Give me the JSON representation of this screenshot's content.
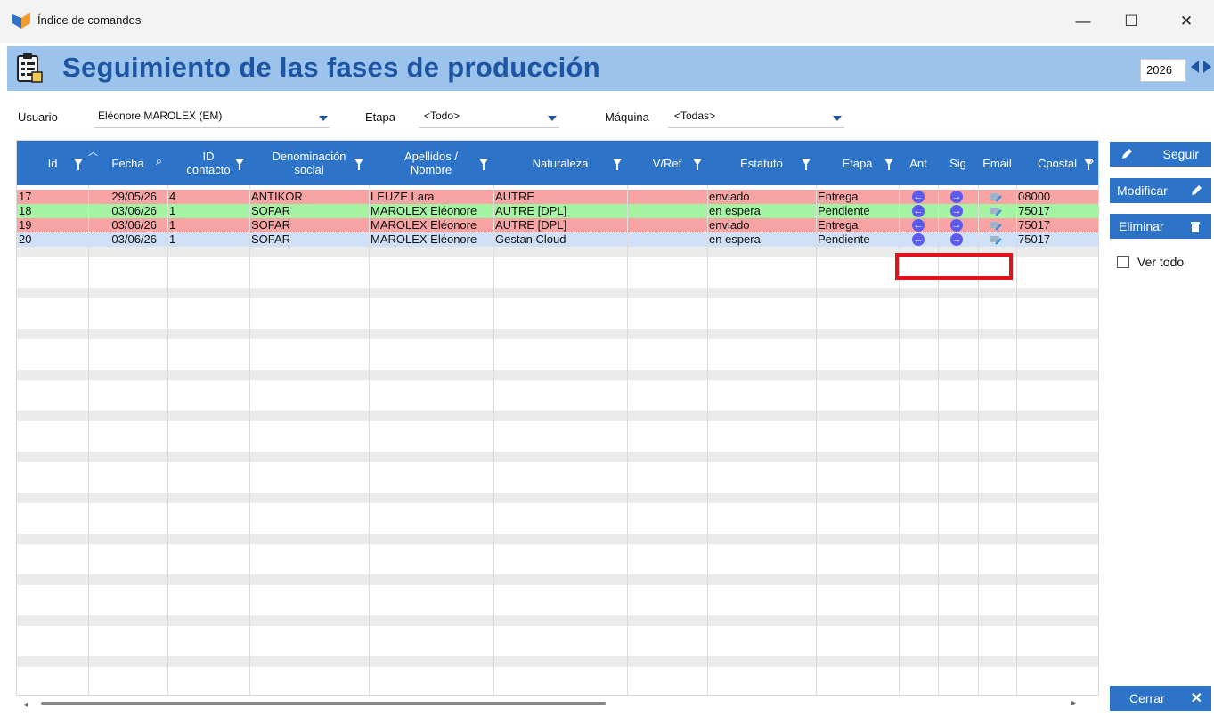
{
  "window": {
    "title": "Índice de comandos",
    "minimize": "—",
    "maximize": "☐",
    "close": "✕"
  },
  "header": {
    "title": "Seguimiento de las fases de producción",
    "year": "2026"
  },
  "filters": {
    "user_label": "Usuario",
    "user_value": "Eléonore MAROLEX (EM)",
    "stage_label": "Etapa",
    "stage_value": "<Todo>",
    "machine_label": "Máquina",
    "machine_value": "<Todas>"
  },
  "columns": [
    {
      "label": "Id",
      "filter": true
    },
    {
      "label": "Fecha",
      "search": true
    },
    {
      "label": "ID\ncontacto",
      "filter": true
    },
    {
      "label": "Denominación\nsocial",
      "filter": true
    },
    {
      "label": "Apellidos /\nNombre",
      "filter": true
    },
    {
      "label": "Naturaleza",
      "filter": true
    },
    {
      "label": "V/Ref",
      "filter": true
    },
    {
      "label": "Estatuto",
      "filter": true
    },
    {
      "label": "Etapa",
      "filter": true
    },
    {
      "label": "Ant"
    },
    {
      "label": "Sig"
    },
    {
      "label": "Email"
    },
    {
      "label": "Cpostal",
      "filter": true
    }
  ],
  "rows": [
    {
      "id": "17",
      "fecha": "29/05/26",
      "contacto": "4",
      "denominacion": "ANTIKOR",
      "nombre": "LEUZE Lara",
      "naturaleza": "AUTRE",
      "vref": "",
      "estatuto": "enviado",
      "etapa": "Entrega",
      "cpostal": "08000",
      "color": "#f8a4a4"
    },
    {
      "id": "18",
      "fecha": "03/06/26",
      "contacto": "1",
      "denominacion": "SOFAR",
      "nombre": "MAROLEX Eléonore",
      "naturaleza": "AUTRE [DPL]",
      "vref": "",
      "estatuto": "en espera",
      "etapa": "Pendiente",
      "cpostal": "75017",
      "color": "#a4f4a4"
    },
    {
      "id": "19",
      "fecha": "03/06/26",
      "contacto": "1",
      "denominacion": "SOFAR",
      "nombre": "MAROLEX Eléonore",
      "naturaleza": "AUTRE [DPL]",
      "vref": "",
      "estatuto": "enviado",
      "etapa": "Entrega",
      "cpostal": "75017",
      "color": "#f8a4a4"
    },
    {
      "id": "20",
      "fecha": "03/06/26",
      "contacto": "1",
      "denominacion": "SOFAR",
      "nombre": "MAROLEX Eléonore",
      "naturaleza": "Gestan Cloud",
      "vref": "",
      "estatuto": "en espera",
      "etapa": "Pendiente",
      "cpostal": "75017",
      "color": "#cfe0f7",
      "selected": true
    }
  ],
  "buttons": {
    "follow": "Seguir",
    "modify": "Modificar",
    "delete": "Eliminar",
    "show_all": "Ver todo",
    "close": "Cerrar"
  },
  "colors": {
    "accent": "#2d74c8",
    "title": "#1d55a3",
    "header_band": "#9cc3ec",
    "highlight": "#e0121b"
  }
}
